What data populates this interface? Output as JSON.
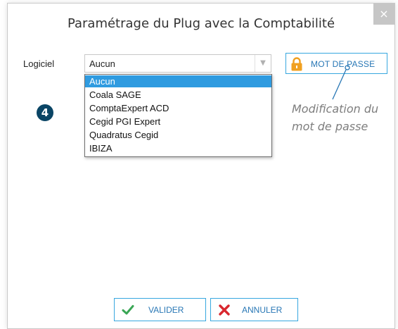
{
  "dialog": {
    "title": "Paramétrage du Plug avec la Comptabilité",
    "close_label": "×"
  },
  "form": {
    "software_label": "Logiciel",
    "software_value": "Aucun",
    "software_options": [
      "Aucun",
      "Coala SAGE",
      "ComptaExpert ACD",
      "Cegid PGI Expert",
      "Quadratus Cegid",
      "IBIZA"
    ],
    "selected_index": 0
  },
  "password_button": {
    "label": "MOT DE PASSE",
    "icon": "lock-icon"
  },
  "annotation": {
    "step_number": "4",
    "callout_line1": "Modification du",
    "callout_line2": "mot de passe"
  },
  "footer": {
    "validate_label": "VALIDER",
    "validate_icon": "check-icon",
    "cancel_label": "ANNULER",
    "cancel_icon": "x-icon"
  },
  "colors": {
    "accent": "#37a7df",
    "selected_bg": "#2f9be0",
    "lock": "#f0a020",
    "check": "#3aa655",
    "cancel_x": "#d9272e",
    "badge": "#0a4565"
  }
}
